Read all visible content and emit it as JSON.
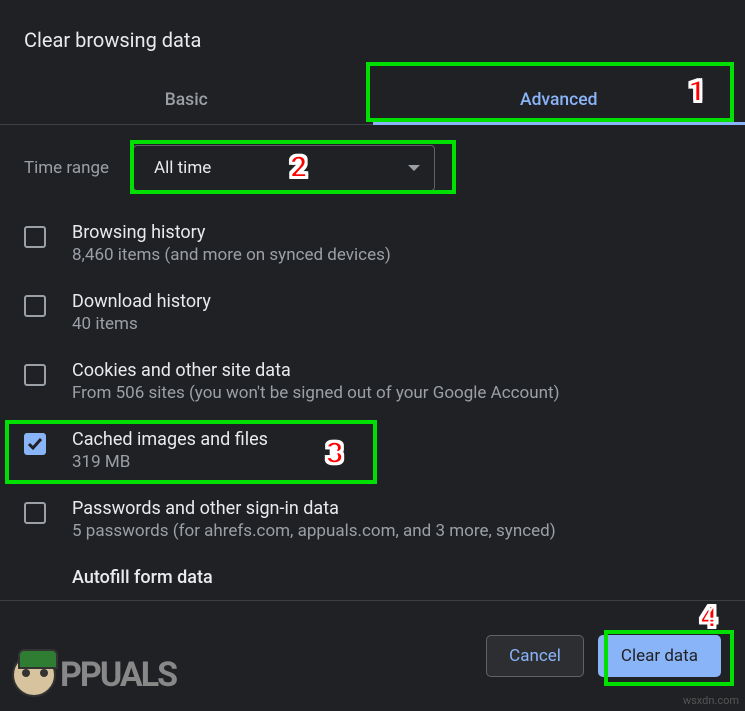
{
  "dialog": {
    "title": "Clear browsing data"
  },
  "tabs": {
    "basic": "Basic",
    "advanced": "Advanced"
  },
  "time_range": {
    "label": "Time range",
    "value": "All time"
  },
  "options": {
    "browsing_history": {
      "title": "Browsing history",
      "sub": "8,460 items (and more on synced devices)",
      "checked": false
    },
    "download_history": {
      "title": "Download history",
      "sub": "40 items",
      "checked": false
    },
    "cookies": {
      "title": "Cookies and other site data",
      "sub": "From 506 sites (you won't be signed out of your Google Account)",
      "checked": false
    },
    "cached": {
      "title": "Cached images and files",
      "sub": "319 MB",
      "checked": true
    },
    "passwords": {
      "title": "Passwords and other sign-in data",
      "sub": "5 passwords (for ahrefs.com, appuals.com, and 3 more, synced)",
      "checked": false
    },
    "autofill": {
      "title": "Autofill form data"
    }
  },
  "footer": {
    "cancel": "Cancel",
    "clear": "Clear data"
  },
  "annotations": {
    "n1": "1",
    "n2": "2",
    "n3": "3",
    "n4": "4"
  },
  "branding": {
    "site": "PPUALS",
    "watermark": "wsxdn.com"
  }
}
